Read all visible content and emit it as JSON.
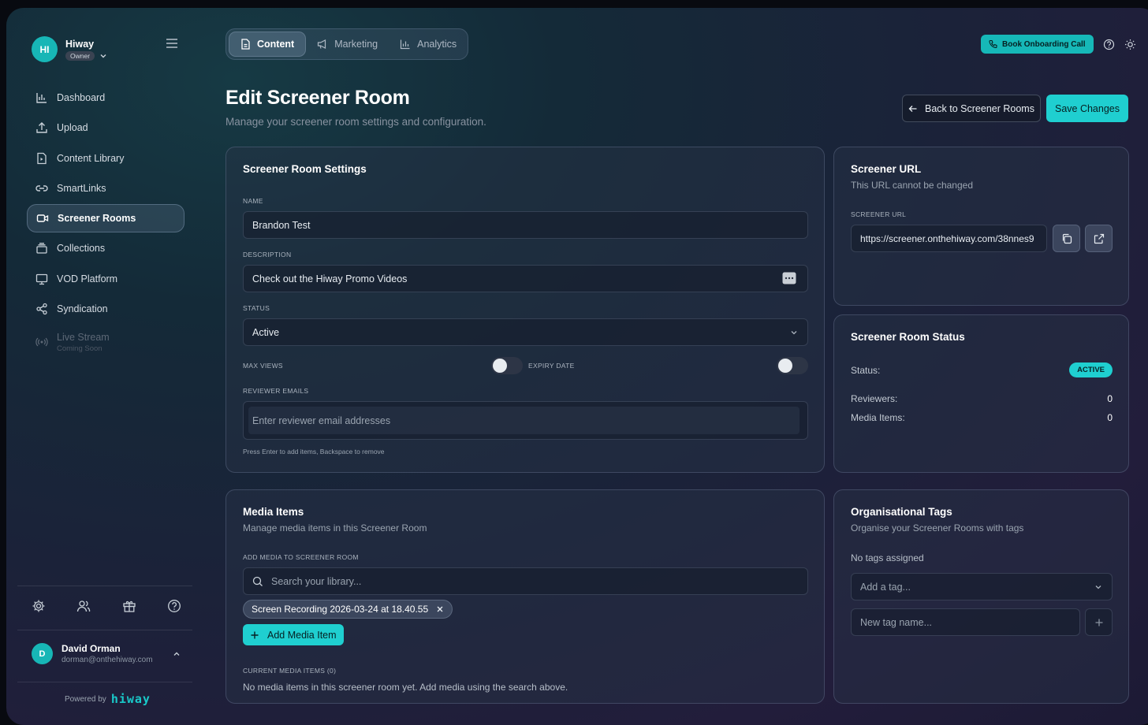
{
  "brand": {
    "initials": "HI",
    "name": "Hiway",
    "role": "Owner"
  },
  "sidebar": {
    "items": [
      {
        "label": "Dashboard",
        "icon": "bar-chart-icon"
      },
      {
        "label": "Upload",
        "icon": "upload-icon"
      },
      {
        "label": "Content Library",
        "icon": "file-play-icon"
      },
      {
        "label": "SmartLinks",
        "icon": "link-icon"
      },
      {
        "label": "Screener Rooms",
        "icon": "video-camera-icon",
        "active": true
      },
      {
        "label": "Collections",
        "icon": "stack-icon"
      },
      {
        "label": "VOD Platform",
        "icon": "monitor-icon"
      },
      {
        "label": "Syndication",
        "icon": "share-icon"
      },
      {
        "label": "Live Stream",
        "icon": "broadcast-icon",
        "disabled": true,
        "sublabel": "Coming Soon"
      }
    ],
    "tools": [
      "gear-icon",
      "users-icon",
      "gift-icon",
      "help-circle-icon"
    ]
  },
  "user": {
    "initial": "D",
    "name": "David Orman",
    "email": "dorman@onthehiway.com"
  },
  "footer": {
    "powered_by": "Powered by",
    "logo": "hiway"
  },
  "tabs": [
    {
      "label": "Content",
      "active": true
    },
    {
      "label": "Marketing"
    },
    {
      "label": "Analytics"
    }
  ],
  "topbar": {
    "onboarding_label": "Book Onboarding Call"
  },
  "header": {
    "title": "Edit Screener Room",
    "subtitle": "Manage your screener room settings and configuration.",
    "back_label": "Back to Screener Rooms",
    "save_label": "Save Changes"
  },
  "settings": {
    "title": "Screener Room Settings",
    "name_label": "NAME",
    "name_value": "Brandon Test",
    "description_label": "DESCRIPTION",
    "description_value": "Check out the Hiway Promo Videos",
    "status_label": "STATUS",
    "status_value": "Active",
    "max_views_label": "MAX VIEWS",
    "expiry_label": "EXPIRY DATE",
    "max_views_enabled": false,
    "expiry_enabled": false,
    "emails_label": "REVIEWER EMAILS",
    "emails_placeholder": "Enter reviewer email addresses",
    "emails_hint": "Press Enter to add items, Backspace to remove"
  },
  "url_card": {
    "title": "Screener URL",
    "subtitle": "This URL cannot be changed",
    "field_label": "SCREENER URL",
    "url": "https://screener.onthehiway.com/38nnes9"
  },
  "status_card": {
    "title": "Screener Room Status",
    "rows": [
      {
        "label": "Status:",
        "badge": "ACTIVE"
      },
      {
        "label": "Reviewers:",
        "value": "0"
      },
      {
        "label": "Media Items:",
        "value": "0"
      }
    ]
  },
  "media": {
    "title": "Media Items",
    "subtitle": "Manage media items in this Screener Room",
    "add_label": "ADD MEDIA TO SCREENER ROOM",
    "search_placeholder": "Search your library...",
    "chip": "Screen Recording 2026-03-24 at 18.40.55",
    "add_button": "Add Media Item",
    "current_label": "CURRENT MEDIA ITEMS (0)",
    "empty_text": "No media items in this screener room yet. Add media using the search above."
  },
  "tags": {
    "title": "Organisational Tags",
    "subtitle": "Organise your Screener Rooms with tags",
    "none_text": "No tags assigned",
    "select_placeholder": "Add a tag...",
    "new_placeholder": "New tag name..."
  },
  "colors": {
    "accent": "#1fcfd0",
    "brand": "#17b6b6"
  }
}
